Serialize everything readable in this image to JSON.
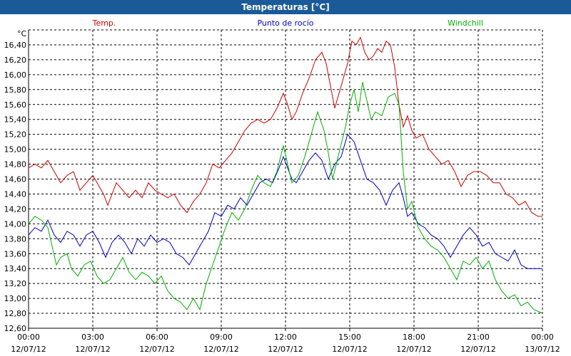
{
  "window": {
    "title": "Temperaturas [°C]"
  },
  "colors": {
    "titlebar": "#1a5a99",
    "grid": "#000000",
    "temp": "#d00000",
    "dew": "#0000c0",
    "windchill": "#00b000"
  },
  "chart_data": {
    "type": "line",
    "ylabel": "°C",
    "ylim": [
      12.6,
      16.6
    ],
    "ytick_values": [
      12.6,
      12.8,
      13.0,
      13.2,
      13.4,
      13.6,
      13.8,
      14.0,
      14.2,
      14.4,
      14.6,
      14.8,
      15.0,
      15.2,
      15.4,
      15.6,
      15.8,
      16.0,
      16.2,
      16.4
    ],
    "ytick_labels": [
      "12,60",
      "12,80",
      "13,00",
      "13,20",
      "13,40",
      "13,60",
      "13,80",
      "14,00",
      "14,20",
      "14,40",
      "14,60",
      "14,80",
      "15,00",
      "15,20",
      "15,40",
      "15,60",
      "15,80",
      "16,00",
      "16,20",
      "16,40"
    ],
    "xlim": [
      0,
      24
    ],
    "xticks": [
      {
        "value": 0,
        "time": "00:00",
        "date": "12/07/12"
      },
      {
        "value": 3,
        "time": "03:00",
        "date": "12/07/12"
      },
      {
        "value": 6,
        "time": "06:00",
        "date": "12/07/12"
      },
      {
        "value": 9,
        "time": "09:00",
        "date": "12/07/12"
      },
      {
        "value": 12,
        "time": "12:00",
        "date": "12/07/12"
      },
      {
        "value": 15,
        "time": "15:00",
        "date": "12/07/12"
      },
      {
        "value": 18,
        "time": "18:00",
        "date": "12/07/12"
      },
      {
        "value": 21,
        "time": "21:00",
        "date": "12/07/12"
      },
      {
        "value": 24,
        "time": "00:00",
        "date": "13/07/12"
      }
    ],
    "grid": true,
    "series": [
      {
        "name": "Temp.",
        "color": "#d00000",
        "points": [
          [
            0,
            14.75
          ],
          [
            0.3,
            14.8
          ],
          [
            0.6,
            14.75
          ],
          [
            0.9,
            14.85
          ],
          [
            1.2,
            14.7
          ],
          [
            1.5,
            14.55
          ],
          [
            1.8,
            14.65
          ],
          [
            2.1,
            14.7
          ],
          [
            2.4,
            14.45
          ],
          [
            2.7,
            14.55
          ],
          [
            3.0,
            14.65
          ],
          [
            3.2,
            14.55
          ],
          [
            3.5,
            14.4
          ],
          [
            3.7,
            14.25
          ],
          [
            3.9,
            14.4
          ],
          [
            4.1,
            14.55
          ],
          [
            4.4,
            14.45
          ],
          [
            4.7,
            14.35
          ],
          [
            5.0,
            14.45
          ],
          [
            5.3,
            14.35
          ],
          [
            5.6,
            14.55
          ],
          [
            5.9,
            14.45
          ],
          [
            6.2,
            14.4
          ],
          [
            6.5,
            14.35
          ],
          [
            6.8,
            14.4
          ],
          [
            7.1,
            14.25
          ],
          [
            7.4,
            14.15
          ],
          [
            7.7,
            14.3
          ],
          [
            8.0,
            14.4
          ],
          [
            8.3,
            14.55
          ],
          [
            8.6,
            14.8
          ],
          [
            8.9,
            14.75
          ],
          [
            9.2,
            14.85
          ],
          [
            9.5,
            14.95
          ],
          [
            9.8,
            15.1
          ],
          [
            10.1,
            15.25
          ],
          [
            10.4,
            15.35
          ],
          [
            10.7,
            15.4
          ],
          [
            11.0,
            15.35
          ],
          [
            11.3,
            15.4
          ],
          [
            11.6,
            15.55
          ],
          [
            11.9,
            15.75
          ],
          [
            12.1,
            15.6
          ],
          [
            12.3,
            15.4
          ],
          [
            12.5,
            15.5
          ],
          [
            12.8,
            15.75
          ],
          [
            13.1,
            15.95
          ],
          [
            13.4,
            16.2
          ],
          [
            13.7,
            16.3
          ],
          [
            13.9,
            16.15
          ],
          [
            14.1,
            15.85
          ],
          [
            14.3,
            15.55
          ],
          [
            14.5,
            15.75
          ],
          [
            14.7,
            15.95
          ],
          [
            14.9,
            16.15
          ],
          [
            15.1,
            16.45
          ],
          [
            15.3,
            16.4
          ],
          [
            15.5,
            16.5
          ],
          [
            15.7,
            16.3
          ],
          [
            15.9,
            16.2
          ],
          [
            16.1,
            16.25
          ],
          [
            16.3,
            16.35
          ],
          [
            16.5,
            16.3
          ],
          [
            16.7,
            16.45
          ],
          [
            16.9,
            16.4
          ],
          [
            17.1,
            16.1
          ],
          [
            17.3,
            15.6
          ],
          [
            17.5,
            15.3
          ],
          [
            17.7,
            15.45
          ],
          [
            17.9,
            15.25
          ],
          [
            18.1,
            15.15
          ],
          [
            18.4,
            15.2
          ],
          [
            18.7,
            15.0
          ],
          [
            19.0,
            14.9
          ],
          [
            19.3,
            14.8
          ],
          [
            19.6,
            14.85
          ],
          [
            19.9,
            14.7
          ],
          [
            20.2,
            14.5
          ],
          [
            20.5,
            14.65
          ],
          [
            20.8,
            14.7
          ],
          [
            21.1,
            14.7
          ],
          [
            21.4,
            14.65
          ],
          [
            21.7,
            14.55
          ],
          [
            22.0,
            14.55
          ],
          [
            22.3,
            14.4
          ],
          [
            22.6,
            14.35
          ],
          [
            22.9,
            14.25
          ],
          [
            23.2,
            14.3
          ],
          [
            23.5,
            14.15
          ],
          [
            23.8,
            14.1
          ],
          [
            24,
            14.1
          ]
        ]
      },
      {
        "name": "Punto de rocío",
        "color": "#0000c0",
        "points": [
          [
            0,
            13.85
          ],
          [
            0.3,
            13.95
          ],
          [
            0.6,
            13.9
          ],
          [
            0.9,
            14.05
          ],
          [
            1.2,
            13.85
          ],
          [
            1.5,
            13.75
          ],
          [
            1.8,
            13.9
          ],
          [
            2.1,
            13.85
          ],
          [
            2.4,
            13.7
          ],
          [
            2.7,
            13.85
          ],
          [
            3.0,
            13.9
          ],
          [
            3.3,
            13.75
          ],
          [
            3.6,
            13.55
          ],
          [
            3.9,
            13.75
          ],
          [
            4.2,
            13.85
          ],
          [
            4.5,
            13.75
          ],
          [
            4.8,
            13.6
          ],
          [
            5.1,
            13.8
          ],
          [
            5.4,
            13.7
          ],
          [
            5.7,
            13.85
          ],
          [
            6.0,
            13.75
          ],
          [
            6.3,
            13.8
          ],
          [
            6.6,
            13.75
          ],
          [
            6.9,
            13.6
          ],
          [
            7.2,
            13.55
          ],
          [
            7.5,
            13.45
          ],
          [
            7.8,
            13.6
          ],
          [
            8.1,
            13.75
          ],
          [
            8.4,
            13.9
          ],
          [
            8.7,
            14.15
          ],
          [
            9.0,
            14.1
          ],
          [
            9.3,
            14.25
          ],
          [
            9.6,
            14.2
          ],
          [
            9.9,
            14.35
          ],
          [
            10.2,
            14.25
          ],
          [
            10.5,
            14.4
          ],
          [
            10.8,
            14.55
          ],
          [
            11.1,
            14.6
          ],
          [
            11.4,
            14.55
          ],
          [
            11.7,
            14.75
          ],
          [
            11.9,
            14.9
          ],
          [
            12.1,
            14.75
          ],
          [
            12.3,
            14.6
          ],
          [
            12.5,
            14.55
          ],
          [
            12.8,
            14.7
          ],
          [
            13.1,
            14.85
          ],
          [
            13.4,
            14.95
          ],
          [
            13.7,
            14.85
          ],
          [
            14.0,
            14.6
          ],
          [
            14.3,
            14.8
          ],
          [
            14.6,
            14.9
          ],
          [
            14.9,
            15.2
          ],
          [
            15.2,
            15.1
          ],
          [
            15.5,
            14.85
          ],
          [
            15.8,
            14.6
          ],
          [
            16.1,
            14.55
          ],
          [
            16.4,
            14.45
          ],
          [
            16.7,
            14.25
          ],
          [
            17.0,
            14.45
          ],
          [
            17.3,
            14.55
          ],
          [
            17.5,
            14.35
          ],
          [
            17.7,
            14.1
          ],
          [
            17.9,
            14.15
          ],
          [
            18.2,
            14.0
          ],
          [
            18.5,
            13.95
          ],
          [
            18.8,
            13.85
          ],
          [
            19.1,
            13.8
          ],
          [
            19.4,
            13.7
          ],
          [
            19.7,
            13.55
          ],
          [
            20.0,
            13.7
          ],
          [
            20.3,
            13.85
          ],
          [
            20.6,
            13.95
          ],
          [
            20.9,
            13.85
          ],
          [
            21.2,
            13.7
          ],
          [
            21.5,
            13.75
          ],
          [
            21.8,
            13.6
          ],
          [
            22.1,
            13.55
          ],
          [
            22.4,
            13.5
          ],
          [
            22.7,
            13.65
          ],
          [
            23.0,
            13.45
          ],
          [
            23.3,
            13.4
          ],
          [
            23.6,
            13.4
          ],
          [
            24,
            13.4
          ]
        ]
      },
      {
        "name": "Windchill",
        "color": "#00b000",
        "points": [
          [
            0,
            14.0
          ],
          [
            0.3,
            14.1
          ],
          [
            0.6,
            14.05
          ],
          [
            0.9,
            13.95
          ],
          [
            1.1,
            13.7
          ],
          [
            1.3,
            13.45
          ],
          [
            1.5,
            13.55
          ],
          [
            1.8,
            13.6
          ],
          [
            2.0,
            13.4
          ],
          [
            2.3,
            13.3
          ],
          [
            2.6,
            13.45
          ],
          [
            2.9,
            13.5
          ],
          [
            3.2,
            13.3
          ],
          [
            3.5,
            13.2
          ],
          [
            3.8,
            13.25
          ],
          [
            4.1,
            13.4
          ],
          [
            4.4,
            13.55
          ],
          [
            4.7,
            13.35
          ],
          [
            5.0,
            13.25
          ],
          [
            5.3,
            13.35
          ],
          [
            5.6,
            13.3
          ],
          [
            5.9,
            13.2
          ],
          [
            6.2,
            13.3
          ],
          [
            6.5,
            13.1
          ],
          [
            6.8,
            13.0
          ],
          [
            7.1,
            12.95
          ],
          [
            7.4,
            12.85
          ],
          [
            7.7,
            13.0
          ],
          [
            8.0,
            12.85
          ],
          [
            8.3,
            13.2
          ],
          [
            8.6,
            13.45
          ],
          [
            8.9,
            13.7
          ],
          [
            9.2,
            13.95
          ],
          [
            9.5,
            14.15
          ],
          [
            9.8,
            14.05
          ],
          [
            10.1,
            14.2
          ],
          [
            10.4,
            14.45
          ],
          [
            10.7,
            14.65
          ],
          [
            11.0,
            14.55
          ],
          [
            11.3,
            14.5
          ],
          [
            11.6,
            14.7
          ],
          [
            11.9,
            15.05
          ],
          [
            12.1,
            14.8
          ],
          [
            12.3,
            14.55
          ],
          [
            12.6,
            14.65
          ],
          [
            12.9,
            14.9
          ],
          [
            13.2,
            15.2
          ],
          [
            13.5,
            15.5
          ],
          [
            13.8,
            15.25
          ],
          [
            14.0,
            14.95
          ],
          [
            14.2,
            14.6
          ],
          [
            14.5,
            14.95
          ],
          [
            14.8,
            15.3
          ],
          [
            15.0,
            15.6
          ],
          [
            15.2,
            15.8
          ],
          [
            15.4,
            15.5
          ],
          [
            15.6,
            15.9
          ],
          [
            15.8,
            15.65
          ],
          [
            16.0,
            15.4
          ],
          [
            16.2,
            15.5
          ],
          [
            16.5,
            15.45
          ],
          [
            16.8,
            15.7
          ],
          [
            17.1,
            15.75
          ],
          [
            17.3,
            15.6
          ],
          [
            17.5,
            14.7
          ],
          [
            17.7,
            14.2
          ],
          [
            17.9,
            14.3
          ],
          [
            18.2,
            13.95
          ],
          [
            18.5,
            13.8
          ],
          [
            18.8,
            13.7
          ],
          [
            19.1,
            13.65
          ],
          [
            19.4,
            13.55
          ],
          [
            19.7,
            13.4
          ],
          [
            20.0,
            13.25
          ],
          [
            20.3,
            13.5
          ],
          [
            20.6,
            13.45
          ],
          [
            20.9,
            13.55
          ],
          [
            21.2,
            13.4
          ],
          [
            21.5,
            13.5
          ],
          [
            21.8,
            13.25
          ],
          [
            22.1,
            13.1
          ],
          [
            22.4,
            13.0
          ],
          [
            22.7,
            13.05
          ],
          [
            23.0,
            12.9
          ],
          [
            23.3,
            12.95
          ],
          [
            23.6,
            12.85
          ],
          [
            24,
            12.8
          ]
        ]
      }
    ]
  }
}
